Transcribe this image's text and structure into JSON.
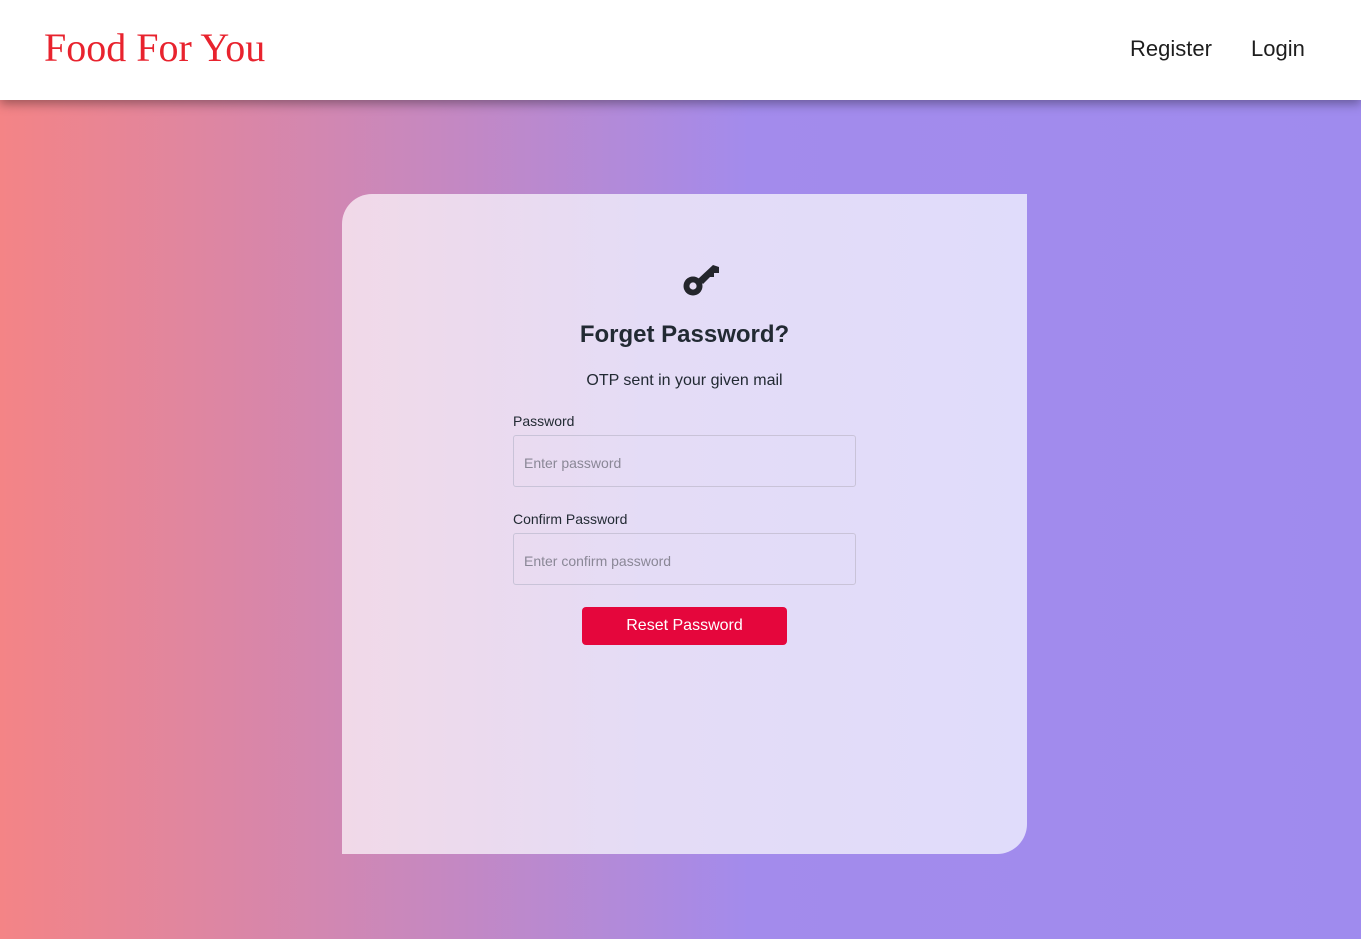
{
  "navbar": {
    "brand": "Food For You",
    "links": [
      {
        "label": "Register"
      },
      {
        "label": "Login"
      }
    ]
  },
  "form": {
    "icon": "key-icon",
    "title": "Forget Password?",
    "subtitle": "OTP sent in your given mail",
    "password": {
      "label": "Password",
      "placeholder": "Enter password",
      "value": ""
    },
    "confirm_password": {
      "label": "Confirm Password",
      "placeholder": "Enter confirm password",
      "value": ""
    },
    "submit_label": "Reset Password"
  },
  "colors": {
    "brand": "#e8232e",
    "button": "#e5063c",
    "gradient_start": "#f48486",
    "gradient_end": "#9f8bee"
  }
}
